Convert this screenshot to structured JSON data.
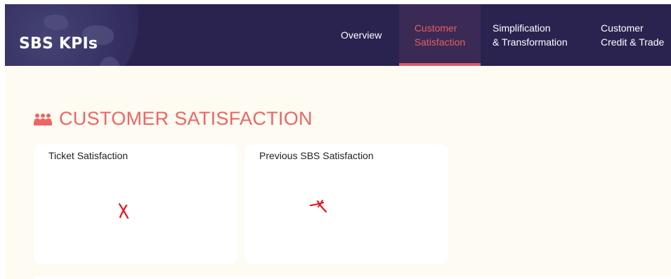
{
  "header": {
    "brand": "SBS KPIs",
    "nav": [
      {
        "label": "Overview"
      },
      {
        "label": "Customer\nSatisfaction",
        "active": true
      },
      {
        "label": "Simplification\n& Transformation"
      },
      {
        "label": "Customer\nCredit & Trade"
      }
    ]
  },
  "section": {
    "title": "CUSTOMER SATISFACTION",
    "icon": "people-meeting-icon"
  },
  "cards": [
    {
      "title": "Ticket Satisfaction",
      "content_icon": "broken-image-icon"
    },
    {
      "title": "Previous SBS Satisfaction",
      "content_icon": "broken-image-icon"
    }
  ],
  "colors": {
    "header_bg": "#2a2350",
    "active_tab_bg": "#3a2a55",
    "accent": "#f06462",
    "active_underline": "#d9596a",
    "page_bg": "#fdfbf2",
    "card_bg": "#ffffff",
    "error_mark": "#e8141b"
  }
}
